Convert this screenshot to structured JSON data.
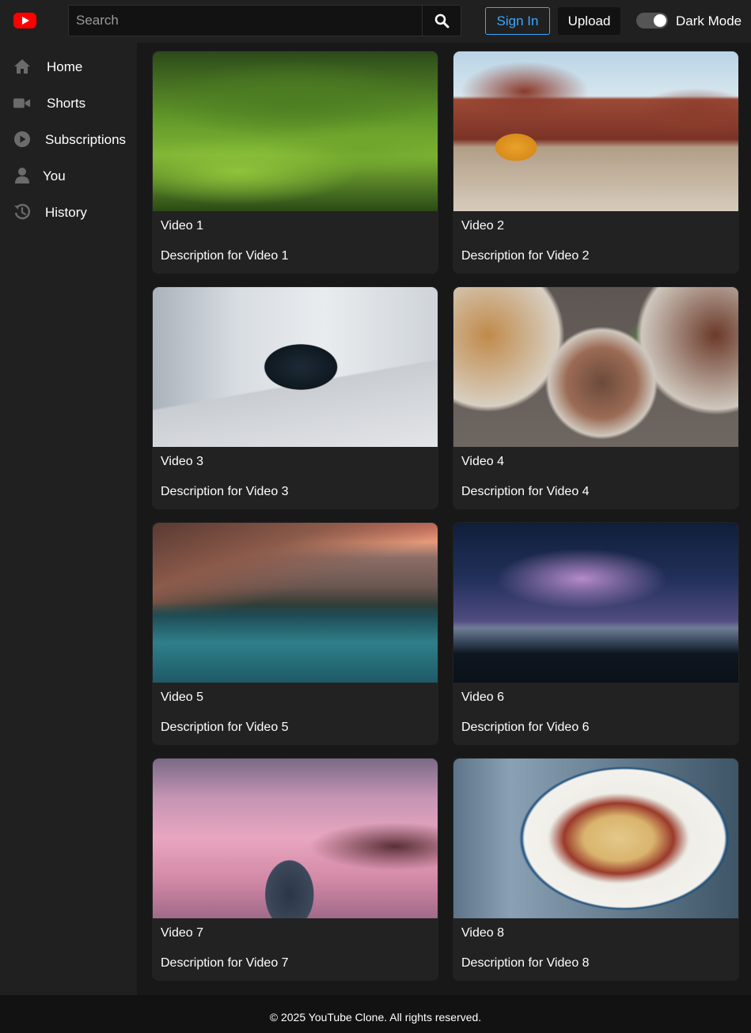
{
  "header": {
    "search_placeholder": "Search",
    "signin_label": "Sign In",
    "upload_label": "Upload",
    "dark_mode_label": "Dark Mode",
    "dark_mode_on": true
  },
  "sidebar": {
    "items": [
      {
        "label": "Home",
        "icon": "home-icon"
      },
      {
        "label": "Shorts",
        "icon": "video-camera-icon"
      },
      {
        "label": "Subscriptions",
        "icon": "play-circle-icon"
      },
      {
        "label": "You",
        "icon": "user-icon"
      },
      {
        "label": "History",
        "icon": "history-icon"
      }
    ]
  },
  "videos": [
    {
      "title": "Video 1",
      "description": "Description for Video 1"
    },
    {
      "title": "Video 2",
      "description": "Description for Video 2"
    },
    {
      "title": "Video 3",
      "description": "Description for Video 3"
    },
    {
      "title": "Video 4",
      "description": "Description for Video 4"
    },
    {
      "title": "Video 5",
      "description": "Description for Video 5"
    },
    {
      "title": "Video 6",
      "description": "Description for Video 6"
    },
    {
      "title": "Video 7",
      "description": "Description for Video 7"
    },
    {
      "title": "Video 8",
      "description": "Description for Video 8"
    }
  ],
  "footer": {
    "text": "© 2025 YouTube Clone. All rights reserved."
  },
  "colors": {
    "brand": "#ff0000",
    "accent": "#3ea6ff",
    "background": "#181818",
    "surface": "#202020"
  }
}
